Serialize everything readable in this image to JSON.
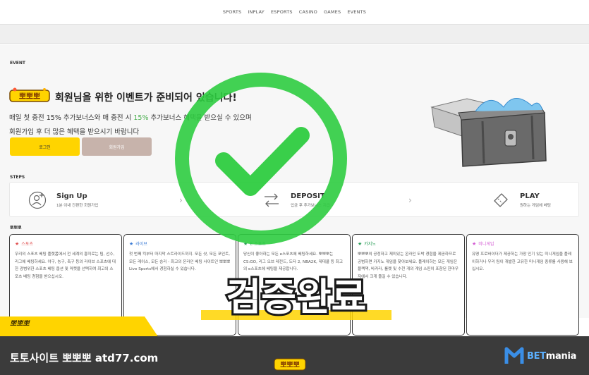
{
  "nav": {
    "items": [
      "SPORTS",
      "INPLAY",
      "ESPORTS",
      "CASINO",
      "GAMES",
      "EVENTS"
    ]
  },
  "event": {
    "section_label": "EVENT",
    "logo_text": "뽀뽀뽀",
    "title": "회원님을 위한 이벤트가 준비되어 있습니다!",
    "line1_a": "매일 첫 충전  15%  추가보너스와 매 충전 시  ",
    "line1_pct": "15%",
    "line1_b": "  추가보너스 혜택을 받으실 수 있으며",
    "line2": "회원가입 후 더 많은 혜택을 받으시기 바랍니다",
    "login_label": "로그인",
    "join_label": "회원가입"
  },
  "steps": {
    "section_label": "STEPS",
    "items": [
      {
        "title": "Sign Up",
        "desc": "1분 이내 간편한 회원가입",
        "icon": "user-plus-icon"
      },
      {
        "title": "DEPOSIT",
        "desc": "입금 후 추가보너스 지급",
        "icon": "transfer-icon"
      },
      {
        "title": "PLAY",
        "desc": "원하는 게임에 베팅",
        "icon": "ticket-icon"
      }
    ]
  },
  "games": {
    "section_label": "뽀뽀뽀",
    "cards": [
      {
        "title": "스포츠",
        "body": "우리의 스포츠 베팅 플랫폼에서 전 세계의 흥미로는 팀, 선수, 리그에 베팅하세요. 야구, 농구, 축구 등의 라이브 스포츠에 대한 광범위한 스포츠 베팅 옵션 및 마켓을 선택하여 최고의 스포츠 베팅 경험을 받으십시오.",
        "accent": "#e05050"
      },
      {
        "title": "라이브",
        "body": "첫 번째 킥부터 마지막 스트라이드까지. 모든 샷, 모든 포인트, 모든 레이스, 모든 승리 - 최고의 온라인 베팅 사이트인 뽀뽀뽀 Live Sports에서 경험하실 수 있습니다.",
        "accent": "#3a7bd5"
      },
      {
        "title": "E-스포츠",
        "body": "당신이 좋아하는 모든 e스포츠에 베팅하세요. 뽀뽀뽀는 CS:GO, 리그 오브 레전드, 도타 2, NBA2K, 데대콜 등 최고의 e스포츠에 베팅을 제공합니다.",
        "accent": "#2e9e5b"
      },
      {
        "title": "카지노",
        "body": "뽀뽀뽀의 공정하고 재미있는 온라인 도박 경험을 제공하므로 공범하면 카지노 게임을 찾아보세요. 플레이하는 모든 게임은 블랙잭, 바카라, 룰렛 및 수천 개의 게임 스핀이 포함된 한마우저에서 크게 즐길 수 있습니다.",
        "accent": "#2e9e5b"
      },
      {
        "title": "미니게임",
        "body": "유명 프로바이더가 제공하는 가장 인기 있는 미니게임을 플레이하거나 우리 팀이 개발한 고유한 미니게임 종류를 사용해 보십시오.",
        "accent": "#d35bd3"
      }
    ]
  },
  "stamp_text": "검증완료",
  "ribbon_text": "뽀뽀뽀",
  "footer": {
    "title": "토토사이트 뽀뽀뽀 atd77.com",
    "brand_a": "BET",
    "brand_b": "mania"
  },
  "colors": {
    "accent_yellow": "#ffd400",
    "check_green": "#2ecc40",
    "footer_bg": "#3b3b3b",
    "join_btn": "#c7b3ab"
  }
}
